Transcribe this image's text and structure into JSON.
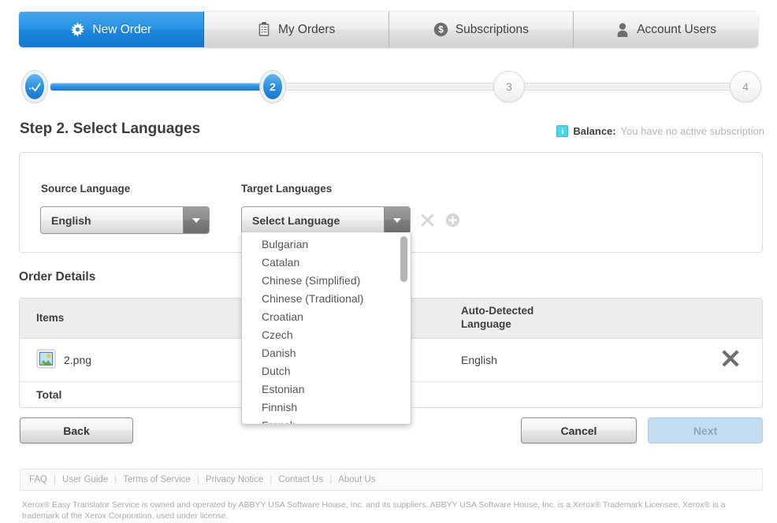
{
  "tabs": [
    {
      "label": "New Order",
      "icon": "starburst-icon",
      "active": true,
      "name": "tab-new-order"
    },
    {
      "label": "My Orders",
      "icon": "clipboard-icon",
      "active": false,
      "name": "tab-my-orders"
    },
    {
      "label": "Subscriptions",
      "icon": "dollar-coin-icon",
      "active": false,
      "name": "tab-subscriptions"
    },
    {
      "label": "Account Users",
      "icon": "user-icon",
      "active": false,
      "name": "tab-account-users"
    }
  ],
  "steps": [
    {
      "label": "✓",
      "state": "done"
    },
    {
      "label": "2",
      "state": "current"
    },
    {
      "label": "3",
      "state": "inactive"
    },
    {
      "label": "4",
      "state": "inactive"
    }
  ],
  "header": {
    "page_title": "Step 2. Select Languages",
    "balance_label": "Balance:",
    "balance_value": "You have no active subscription",
    "info_glyph": "i"
  },
  "languages": {
    "source_label": "Source Language",
    "target_label": "Target Languages",
    "source_value": "English",
    "target_value": "Select Language",
    "remove_icon": "close-x-icon",
    "add_icon": "plus-circle-icon",
    "dropdown_options": [
      "Bulgarian",
      "Catalan",
      "Chinese (Simplified)",
      "Chinese (Traditional)",
      "Croatian",
      "Czech",
      "Danish",
      "Dutch",
      "Estonian",
      "Finnish",
      "French"
    ]
  },
  "order": {
    "section_title": "Order Details",
    "columns": [
      "Items",
      "Auto-Detected\nLanguage"
    ],
    "col_items": "Items",
    "col_language": "Auto-Detected Language",
    "rows": [
      {
        "file_name": "2.png",
        "file_icon": "image-file-icon",
        "detected_language": "English",
        "remove": "✖"
      }
    ],
    "total_label": "Total"
  },
  "actions": {
    "back": "Back",
    "cancel": "Cancel",
    "next": "Next"
  },
  "footer": {
    "links": [
      "FAQ",
      "User Guide",
      "Terms of Service",
      "Privacy Notice",
      "Contact Us",
      "About Us"
    ],
    "copyright": "Xerox® Easy Translator Service is owned and operated by ABBYY USA Software House, Inc. and its suppliers. ABBYY USA Software House, Inc. is a Xerox® Trademark Licensee. Xerox® is a trademark of the Xerox Corporation, used under license."
  },
  "colors": {
    "accent_blue": "#2691e3",
    "info_cyan": "#4fd5e8",
    "next_disabled": "#c3dcf0",
    "muted_text": "#a9a9a9"
  }
}
